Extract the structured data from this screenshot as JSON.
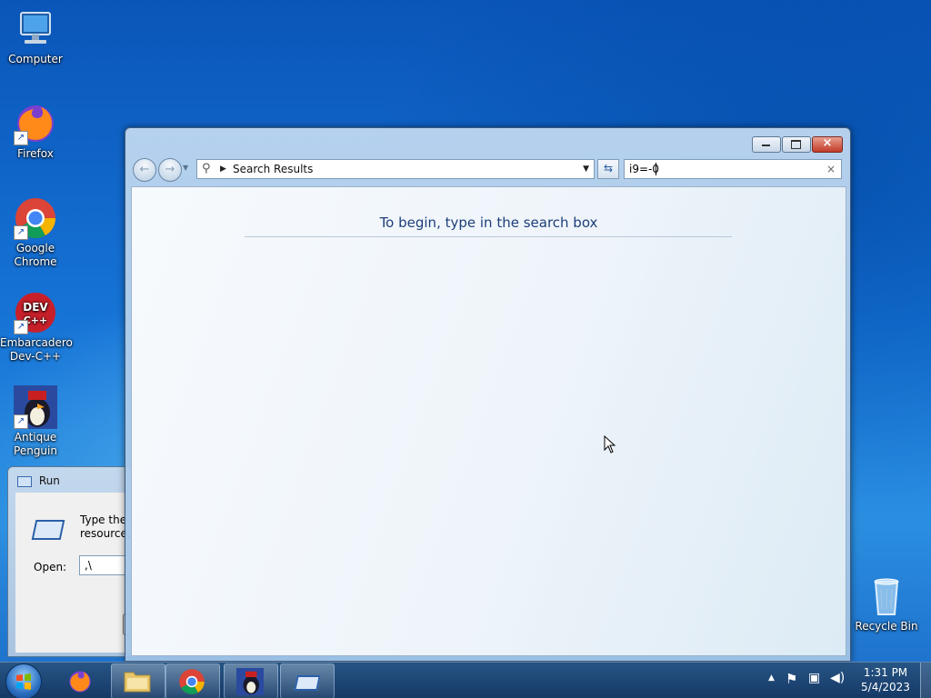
{
  "desktop": {
    "icons": [
      {
        "label": "Computer",
        "icon": "computer-icon"
      },
      {
        "label": "Firefox",
        "icon": "firefox-icon"
      },
      {
        "label": "Google Chrome",
        "icon": "chrome-icon"
      },
      {
        "label": "Embarcadero Dev-C++",
        "icon": "devcpp-icon",
        "badge": "DEV C++"
      },
      {
        "label": "Antique Penguin",
        "icon": "penguin-icon"
      },
      {
        "label": "Recycle Bin",
        "icon": "recycle-bin-icon"
      }
    ]
  },
  "explorer": {
    "address_text": "Search Results",
    "search_value": "i9=-0",
    "empty_message": "To begin, type in the search box"
  },
  "run_dialog": {
    "title": "Run",
    "desc_line1": "Type the n",
    "desc_line2": "resource, a",
    "open_label": "Open:",
    "open_value": ",\\"
  },
  "taskbar": {
    "items": [
      "start-orb",
      "firefox",
      "windows-explorer",
      "google-chrome",
      "antique-penguin",
      "run"
    ],
    "time": "1:31 PM",
    "date": "5/4/2023"
  },
  "colors": {
    "accent_text": "#1e3f7a",
    "close_button": "#c23a28"
  }
}
